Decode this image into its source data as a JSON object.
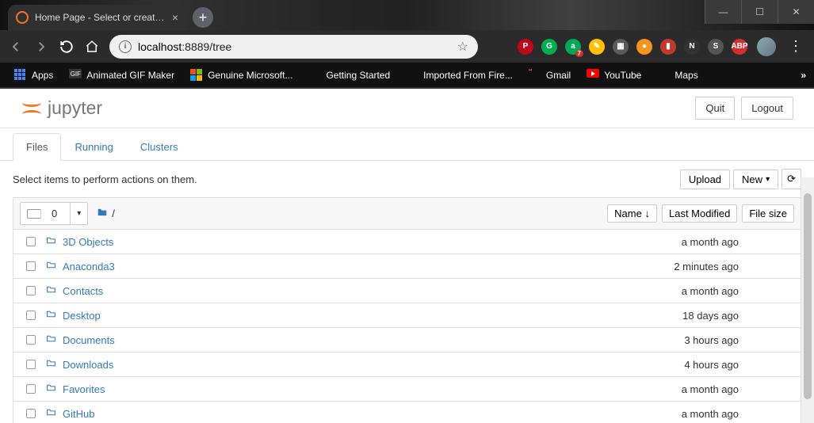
{
  "browser": {
    "tab_title": "Home Page - Select or create a n",
    "url_host": "localhost",
    "url_rest": ":8889/tree",
    "new_tab": "+",
    "close": "×",
    "win": {
      "min": "—",
      "max": "☐",
      "close": "✕"
    }
  },
  "bookmarks": [
    {
      "label": "Apps",
      "color": "#fff",
      "icon": "grid"
    },
    {
      "label": "Animated GIF Maker",
      "icon": "gif"
    },
    {
      "label": "Genuine Microsoft...",
      "icon": "ms"
    },
    {
      "label": "Getting Started",
      "icon": "ff"
    },
    {
      "label": "Imported From Fire...",
      "icon": "folder"
    },
    {
      "label": "Gmail",
      "icon": "gmail"
    },
    {
      "label": "YouTube",
      "icon": "yt"
    },
    {
      "label": "Maps",
      "icon": "maps"
    }
  ],
  "extensions": [
    {
      "bg": "#bd081c",
      "txt": "P"
    },
    {
      "bg": "#00b050",
      "txt": "G"
    },
    {
      "bg": "#00a859",
      "txt": "a",
      "badge": "7"
    },
    {
      "bg": "#ffc107",
      "txt": "✎"
    },
    {
      "bg": "#5a5a5a",
      "txt": "▦"
    },
    {
      "bg": "#f7931e",
      "txt": "●"
    },
    {
      "bg": "#c0392b",
      "txt": "▮"
    },
    {
      "bg": "#333",
      "txt": "N"
    },
    {
      "bg": "#555",
      "txt": "S"
    },
    {
      "bg": "#d32f2f",
      "txt": "ABP"
    }
  ],
  "jupyter": {
    "logo_text": "jupyter",
    "quit": "Quit",
    "logout": "Logout",
    "tabs": {
      "files": "Files",
      "running": "Running",
      "clusters": "Clusters"
    },
    "hint": "Select items to perform actions on them.",
    "upload": "Upload",
    "new": "New",
    "refresh_icon": "⟳",
    "select_count": "0",
    "breadcrumb": "/",
    "columns": {
      "name": "Name",
      "modified": "Last Modified",
      "size": "File size"
    },
    "sort_icon": "↓",
    "items": [
      {
        "name": "3D Objects",
        "modified": "a month ago"
      },
      {
        "name": "Anaconda3",
        "modified": "2 minutes ago"
      },
      {
        "name": "Contacts",
        "modified": "a month ago"
      },
      {
        "name": "Desktop",
        "modified": "18 days ago"
      },
      {
        "name": "Documents",
        "modified": "3 hours ago"
      },
      {
        "name": "Downloads",
        "modified": "4 hours ago"
      },
      {
        "name": "Favorites",
        "modified": "a month ago"
      },
      {
        "name": "GitHub",
        "modified": "a month ago"
      }
    ]
  }
}
